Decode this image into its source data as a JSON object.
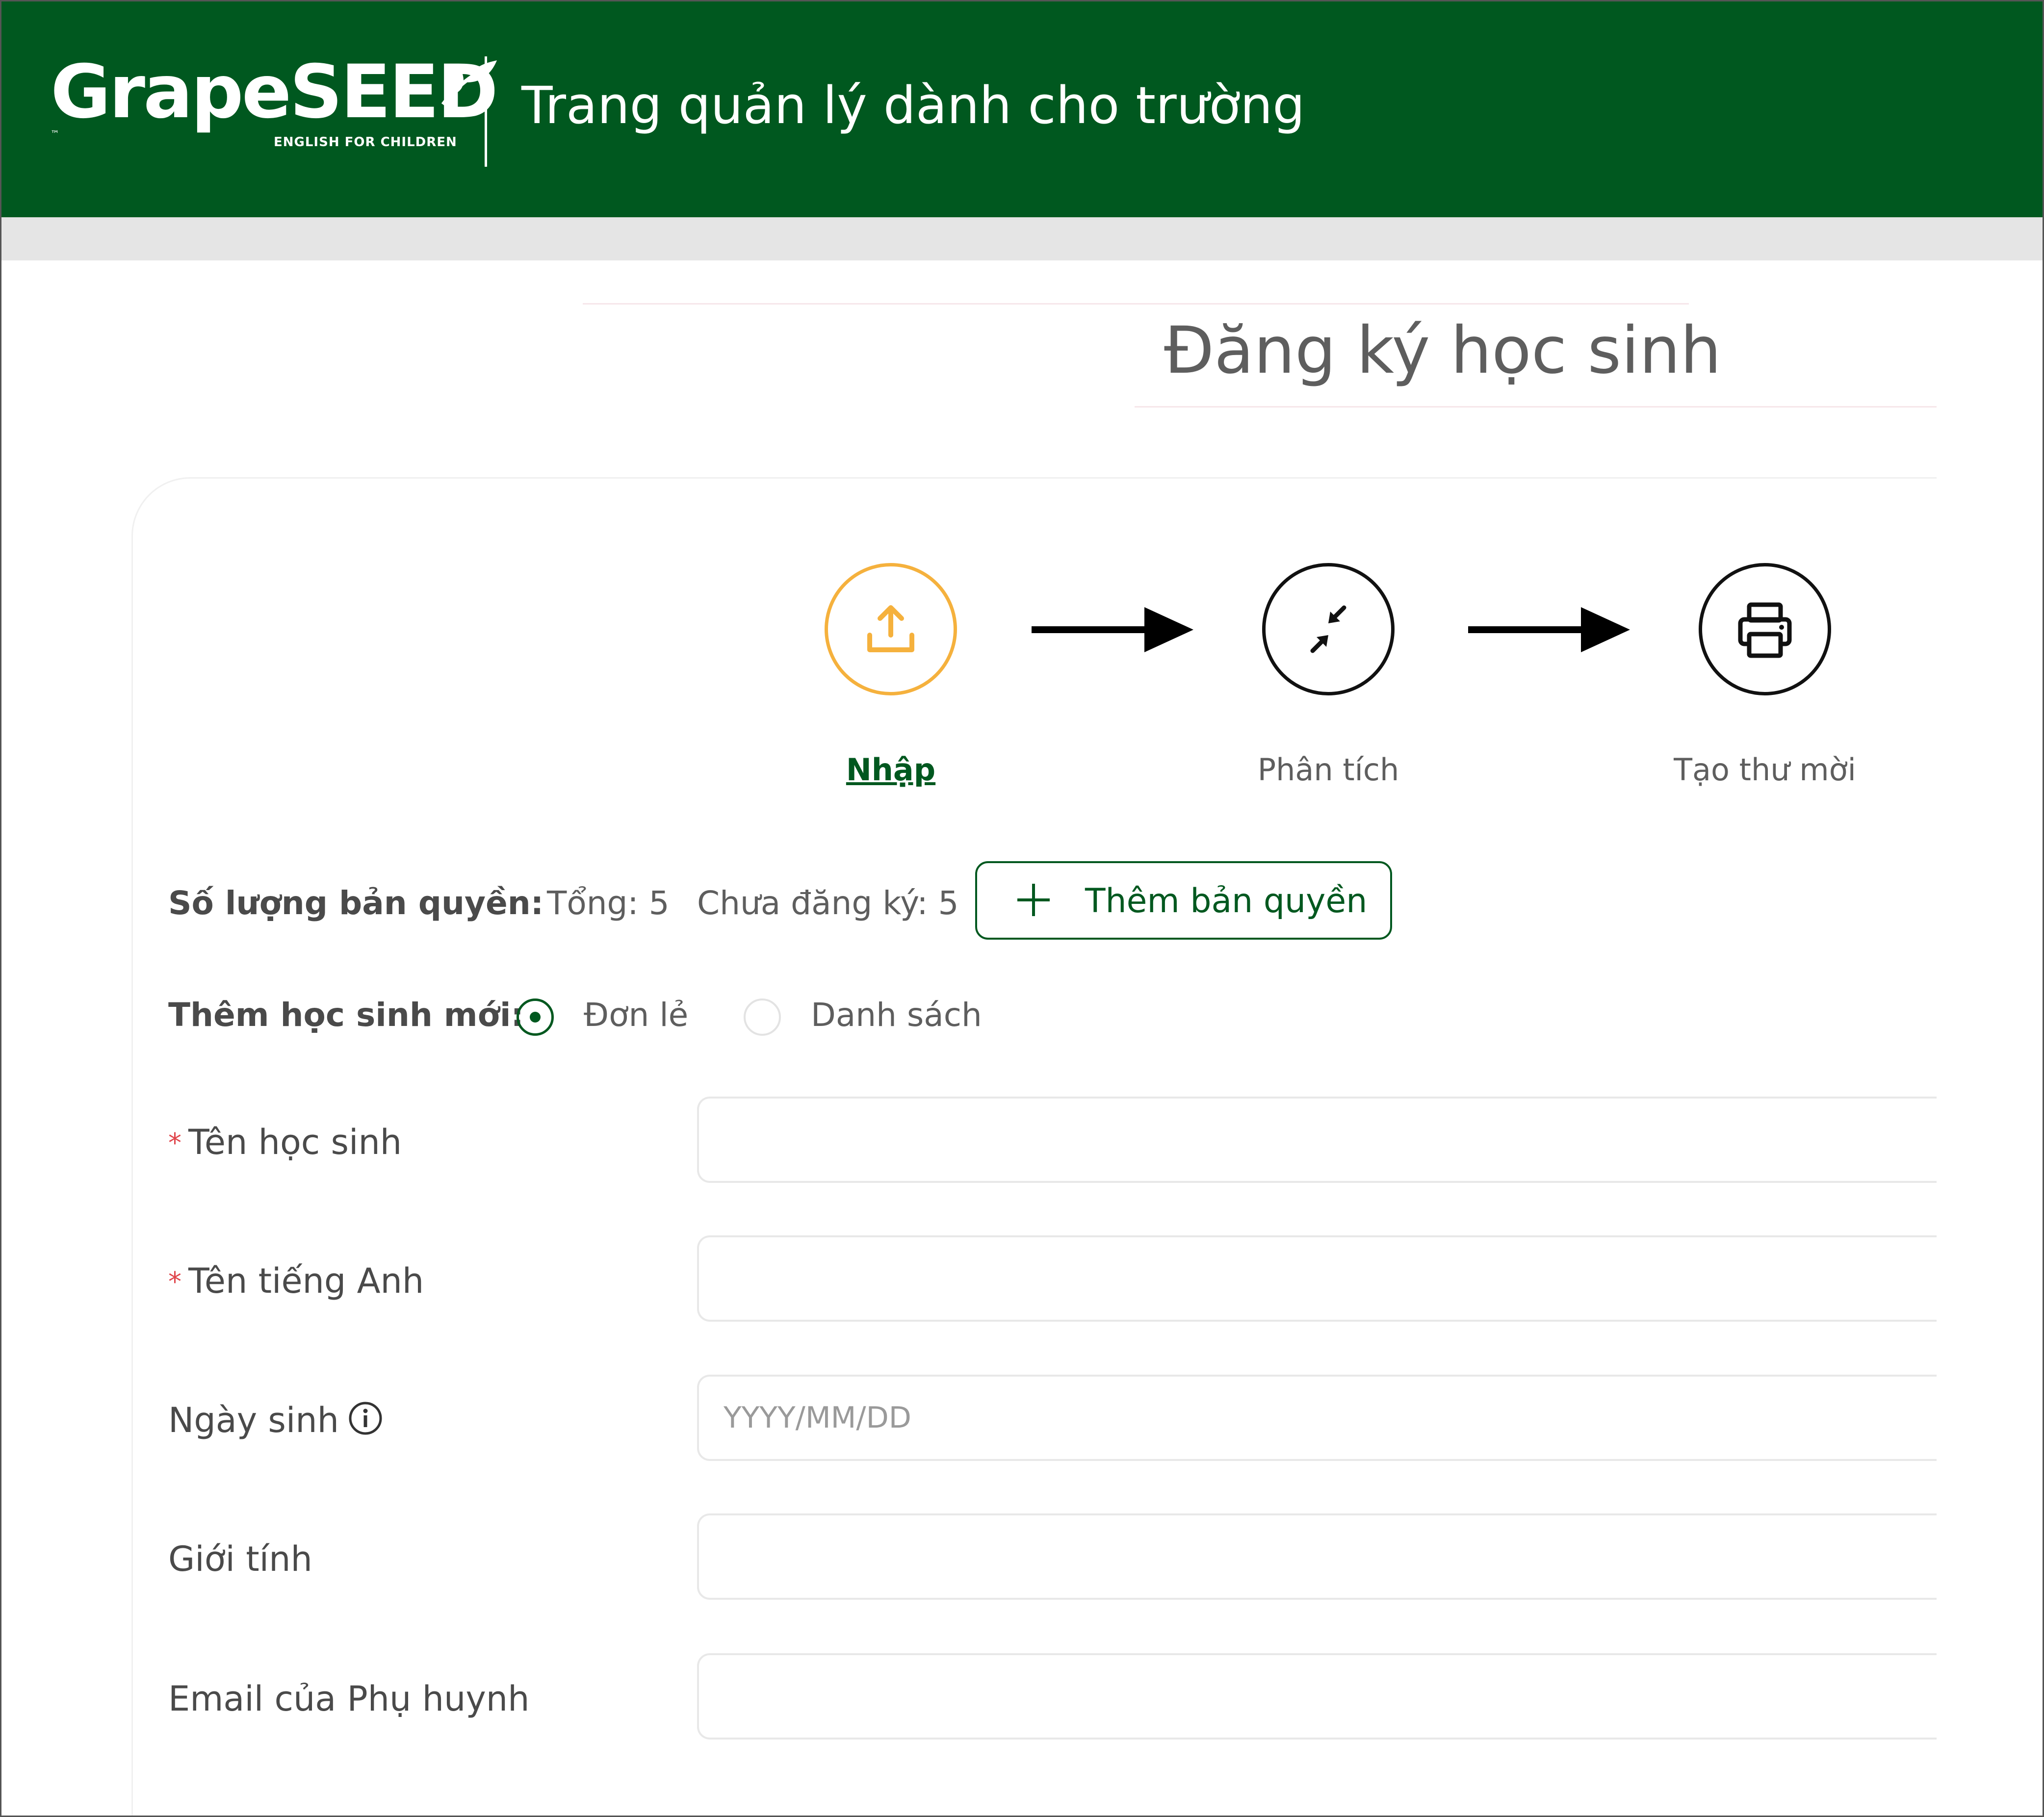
{
  "header": {
    "logo_text": "GrapeSEED",
    "logo_tagline": "ENGLISH FOR CHILDREN",
    "logo_tm": "™",
    "title": "Trang quản lý dành cho trường",
    "background_color": "#00581f"
  },
  "page": {
    "title": "Đăng ký học sinh"
  },
  "steps": [
    {
      "label": "Nhập",
      "icon": "upload-icon",
      "active": true,
      "color": "#f5b13d"
    },
    {
      "label": "Phân tích",
      "icon": "compress-arrows-icon",
      "active": false,
      "color": "#111111"
    },
    {
      "label": "Tạo thư mời",
      "icon": "printer-icon",
      "active": false,
      "color": "#111111"
    }
  ],
  "license": {
    "label": "Số lượng bản quyền:",
    "total": "Tổng: 5",
    "unregistered": "Chưa đăng ký: 5",
    "add_button": "Thêm bản quyền"
  },
  "add_student": {
    "label": "Thêm học sinh mới:",
    "options": [
      {
        "label": "Đơn lẻ",
        "selected": true
      },
      {
        "label": "Danh sách",
        "selected": false
      }
    ]
  },
  "form": {
    "student_name": {
      "label": "Tên học sinh",
      "required": true,
      "value": ""
    },
    "english_name": {
      "label": "Tên tiếng Anh",
      "required": true,
      "value": ""
    },
    "birthday": {
      "label": "Ngày sinh",
      "placeholder": "YYYY/MM/DD",
      "value": ""
    },
    "gender": {
      "label": "Giới tính",
      "value": ""
    },
    "parent_email": {
      "label": "Email của Phụ huynh",
      "value": ""
    }
  },
  "colors": {
    "accent_green": "#00581f",
    "step_active": "#f5b13d",
    "required_mark": "#e0464c"
  }
}
